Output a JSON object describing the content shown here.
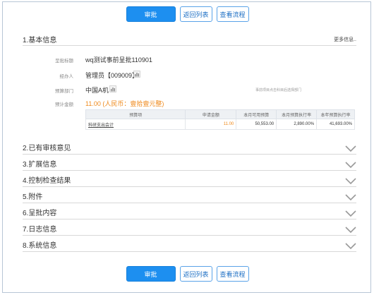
{
  "toolbar": {
    "approve_label": "审批",
    "return_label": "返回列表",
    "flow_label": "查看流程"
  },
  "basic": {
    "title": "1.基本信息",
    "more_label": "更多信息..",
    "fields": {
      "subject_label": "呈批标题",
      "subject_value": "wq测试事前呈批110901",
      "handler_label": "经办人",
      "handler_value": "管理员【009009】",
      "dept_label": "预算部门",
      "dept_value": "中国A机",
      "amount_label": "预计金额",
      "amount_value": "11.00 (人民币：壹拾壹元整)"
    },
    "hint": "事前项目点击科目后选择部门"
  },
  "budget_table": {
    "headers": [
      "预算项",
      "申请金额",
      "本月可用预算",
      "本月预算执行率",
      "本年预算执行率"
    ],
    "rows": [
      [
        "科研支出会计",
        "11.00",
        "50,553.00",
        "2,890.00%",
        "41,693.00%"
      ]
    ]
  },
  "sections": [
    {
      "label": "2.已有审核意见"
    },
    {
      "label": "3.扩展信息"
    },
    {
      "label": "4.控制检查结果"
    },
    {
      "label": "5.附件"
    },
    {
      "label": "6.呈批内容"
    },
    {
      "label": "7.日志信息"
    },
    {
      "label": "8.系统信息"
    }
  ],
  "colors": {
    "primary": "#1d8ff0",
    "amount": "#ef8a1c"
  }
}
